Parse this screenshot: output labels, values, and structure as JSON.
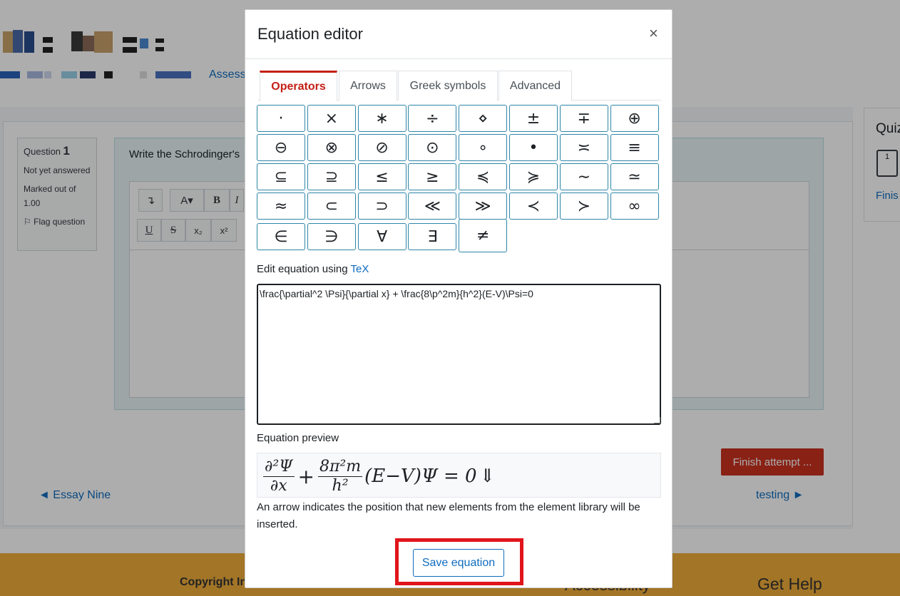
{
  "page": {
    "assess_link": "Assess",
    "question": {
      "label": "Question",
      "number": "1",
      "status": "Not yet answered",
      "marked": "Marked out of 1.00",
      "flag": "Flag question",
      "text": "Write the Schrodinger's"
    },
    "editor_toolbar": {
      "row1": [
        "↴",
        "A▾",
        "B",
        "I"
      ],
      "row2": [
        "U",
        "S",
        "x₂",
        "x²"
      ]
    },
    "finish_button": "Finish attempt ...",
    "prev_link": "◄ Essay Nine",
    "next_link": "testing ►",
    "quiz_nav": {
      "title": "Quiz",
      "box": "1",
      "finish": "Finis"
    },
    "footer": {
      "copyright": "Copyright In",
      "accessibility": "Accessibility",
      "help": "Get Help"
    }
  },
  "modal": {
    "title": "Equation editor",
    "close": "×",
    "tabs": [
      "Operators",
      "Arrows",
      "Greek symbols",
      "Advanced"
    ],
    "active_tab": "Operators",
    "symbols": [
      "·",
      "×",
      "∗",
      "÷",
      "⋄",
      "±",
      "∓",
      "⊕",
      "⊖",
      "⊗",
      "⊘",
      "⊙",
      "∘",
      "•",
      "≍",
      "≡",
      "⊆",
      "⊇",
      "≤",
      "≥",
      "≼",
      "≽",
      "∼",
      "≃",
      "≈",
      "⊂",
      "⊃",
      "≪",
      "≫",
      "≺",
      "≻",
      "∞",
      "∈",
      "∋",
      "∀",
      "∃",
      "≠"
    ],
    "edit_label": "Edit equation using ",
    "tex_link": "TeX",
    "tex_value": "\\frac{\\partial^2 \\Psi}{\\partial x} + \\frac{8\\p^2m}{h^2}(E-V)\\Psi=0",
    "preview_label": "Equation preview",
    "preview": {
      "frac1_num": "∂²Ψ",
      "frac1_den": "∂x",
      "plus": "+",
      "frac2_num": "8π²m",
      "frac2_den": "h²",
      "rest": "(E−V)Ψ = 0",
      "cursor": "⇓"
    },
    "note": "An arrow indicates the position that new elements from the element library will be inserted.",
    "save_button": "Save equation"
  },
  "colors": {
    "accent_red": "#c31e15",
    "link_blue": "#0f6cbf",
    "symbol_border": "#2e86a8",
    "highlight": "#e0151b",
    "footer": "#f0ad3a"
  }
}
